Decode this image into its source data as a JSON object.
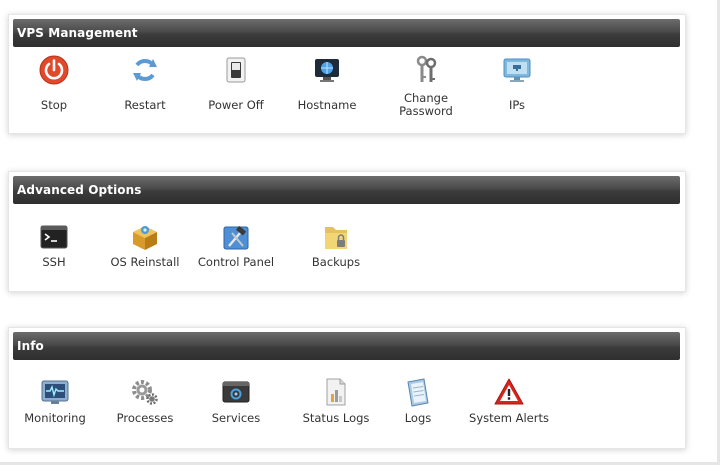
{
  "sections": [
    {
      "title": "VPS Management",
      "items": [
        {
          "label": "Stop",
          "icon": "power-button-icon"
        },
        {
          "label": "Restart",
          "icon": "refresh-arrows-icon"
        },
        {
          "label": "Power Off",
          "icon": "toggle-switch-icon"
        },
        {
          "label": "Hostname",
          "icon": "monitor-globe-icon"
        },
        {
          "label": "Change Password",
          "icon": "keys-icon"
        },
        {
          "label": "IPs",
          "icon": "network-display-icon"
        }
      ]
    },
    {
      "title": "Advanced Options",
      "items": [
        {
          "label": "SSH",
          "icon": "terminal-icon"
        },
        {
          "label": "OS Reinstall",
          "icon": "package-box-icon"
        },
        {
          "label": "Control Panel",
          "icon": "hammer-tools-icon"
        },
        {
          "label": "Backups",
          "icon": "folder-lock-icon"
        }
      ]
    },
    {
      "title": "Info",
      "items": [
        {
          "label": "Monitoring",
          "icon": "heartbeat-monitor-icon"
        },
        {
          "label": "Processes",
          "icon": "gears-icon"
        },
        {
          "label": "Services",
          "icon": "services-window-icon"
        },
        {
          "label": "Status Logs",
          "icon": "document-chart-icon"
        },
        {
          "label": "Logs",
          "icon": "notepad-icon"
        },
        {
          "label": "System Alerts",
          "icon": "warning-triangle-icon"
        }
      ]
    }
  ],
  "colors": {
    "header_top": "#6c6c6c",
    "header_bottom": "#2f2f2f",
    "header_text": "#ffffff",
    "label_text": "#333333",
    "stop_red": "#e04a2a",
    "restart_blue": "#5b9bd5",
    "alert_red": "#d9251c"
  }
}
